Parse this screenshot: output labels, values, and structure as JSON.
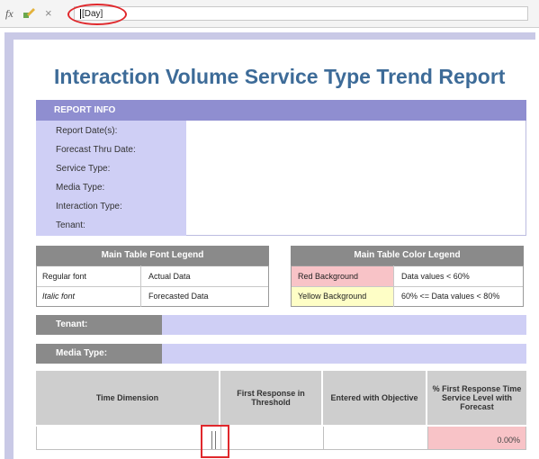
{
  "formula_bar": {
    "fx_label": "fx",
    "cancel_label": "×",
    "formula_value": "[Day]"
  },
  "report": {
    "title": "Interaction Volume Service Type Trend Report",
    "info_header": "REPORT INFO",
    "info_labels": [
      "Report Date(s):",
      "Forecast Thru Date:",
      "Service Type:",
      "Media Type:",
      "Interaction Type:",
      "Tenant:"
    ]
  },
  "font_legend": {
    "title": "Main Table Font Legend",
    "rows": [
      {
        "key": "Regular font",
        "value": "Actual Data"
      },
      {
        "key": "Italic font",
        "value": "Forecasted Data"
      }
    ]
  },
  "color_legend": {
    "title": "Main Table Color Legend",
    "rows": [
      {
        "key": "Red Background",
        "value": "Data values < 60%",
        "color": "#f8c3c7"
      },
      {
        "key": "Yellow Background",
        "value": "60% <= Data values < 80%",
        "color": "#fefec6"
      }
    ]
  },
  "filters": {
    "tenant_label": "Tenant:",
    "media_type_label": "Media Type:"
  },
  "main_table": {
    "headers": [
      "Time Dimension",
      "First Response in Threshold",
      "Entered with Objective",
      "% First Response Time Service Level with Forecast"
    ],
    "row": [
      "",
      "",
      "",
      "0.00%"
    ]
  }
}
